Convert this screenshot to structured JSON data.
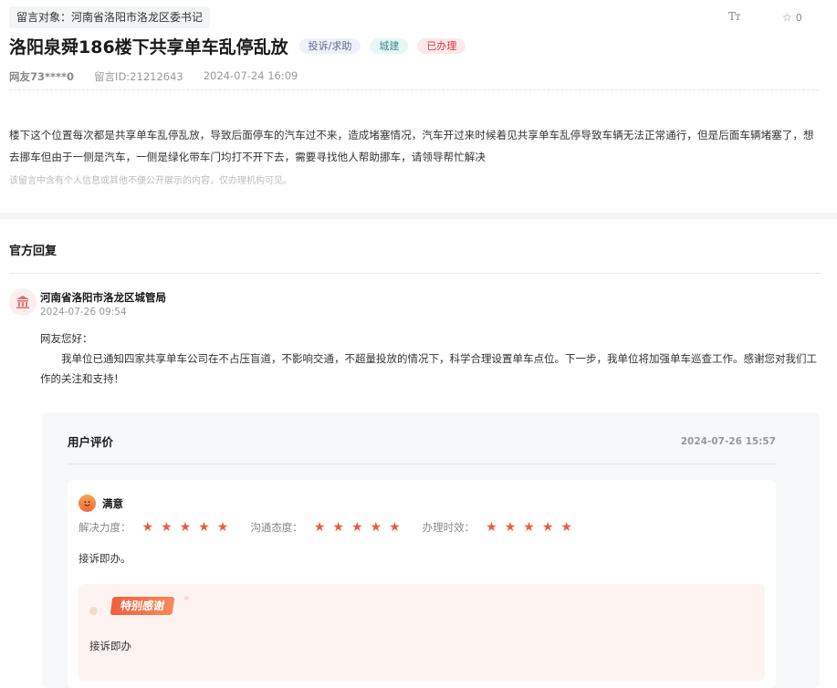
{
  "header": {
    "target_label": "留言对象：河南省洛阳市洛龙区委书记",
    "font_size_button": "Tт",
    "fav_count": "0"
  },
  "message": {
    "title": "洛阳泉舜186楼下共享单车乱停乱放",
    "tags": [
      "投诉/求助",
      "城建",
      "已办理"
    ],
    "user": "网友73****0",
    "message_id": "留言ID:21212643",
    "time": "2024-07-24 16:09",
    "content": "楼下这个位置每次都是共享单车乱停乱放，导致后面停车的汽车过不来，造成堵塞情况，汽车开过来时候着见共享单车乱停导致车辆无法正常通行，但是后面车辆堵塞了，想去挪车但由于一侧是汽车，一侧是绿化带车门均打不开下去，需要寻找他人帮助挪车，请领导帮忙解决",
    "privacy_note": "该留言中含有个人信息或其他不便公开展示的内容，仅办理机构可见。"
  },
  "official_reply": {
    "section_title": "官方回复",
    "org_name": "河南省洛阳市洛龙区城管局",
    "time": "2024-07-26 09:54",
    "greeting": "网友您好：",
    "body": "我单位已通知四家共享单车公司在不占压盲道，不影响交通，不超量投放的情况下，科学合理设置单车点位。下一步，我单位将加强单车巡查工作。感谢您对我们工作的关注和支持！"
  },
  "evaluation": {
    "section_title": "用户评价",
    "time": "2024-07-26 15:57",
    "satisfaction": "满意",
    "ratings": [
      {
        "label": "解决力度：",
        "stars": 5
      },
      {
        "label": "沟通态度：",
        "stars": 5
      },
      {
        "label": "办理时效：",
        "stars": 5
      }
    ],
    "comment": "接诉即办。",
    "thanks_badge": "特别感谢",
    "thanks_text": "接诉即办"
  },
  "colors": {
    "accent_red": "#d9363e",
    "star": "#ee5a3a",
    "thanks_bg": "#fdf3f1"
  },
  "icons": {
    "font_size": "font-size-icon",
    "favorite": "star-outline-icon",
    "org": "government-building-icon",
    "satisfaction": "smiley-icon",
    "rating": "star-filled-icon"
  }
}
